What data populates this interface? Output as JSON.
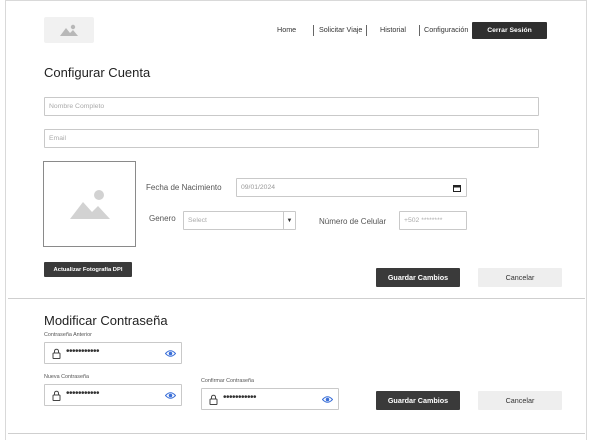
{
  "nav": {
    "items": [
      "Home",
      "Solicitar Viaje",
      "Historial",
      "Configuración"
    ],
    "logout_label": "Cerrar Sesión"
  },
  "account": {
    "title": "Configurar Cuenta",
    "full_name_placeholder": "Nombre Completo",
    "email_placeholder": "Email",
    "birthdate_label": "Fecha de Nacimiento",
    "birthdate_value": "09/01/2024",
    "gender_label": "Genero",
    "gender_value": "Select",
    "phone_label": "Número de Celular",
    "phone_value": "+502 ********",
    "upload_photo_label": "Actualizar Fotografía DPI",
    "save_label": "Guardar Cambios",
    "cancel_label": "Cancelar"
  },
  "password": {
    "title": "Modificar Contraseña",
    "old_label": "Contraseña Anterior",
    "old_value": "•••••••••••",
    "new_label": "Nueva Contraseña",
    "new_value": "•••••••••••",
    "confirm_label": "Confirmar Contraseña",
    "confirm_value": "•••••••••••",
    "save_label": "Guardar Cambios",
    "cancel_label": "Cancelar"
  },
  "colors": {
    "primary_dark": "#2f2f2f",
    "eye_icon": "#3a6fd8"
  }
}
